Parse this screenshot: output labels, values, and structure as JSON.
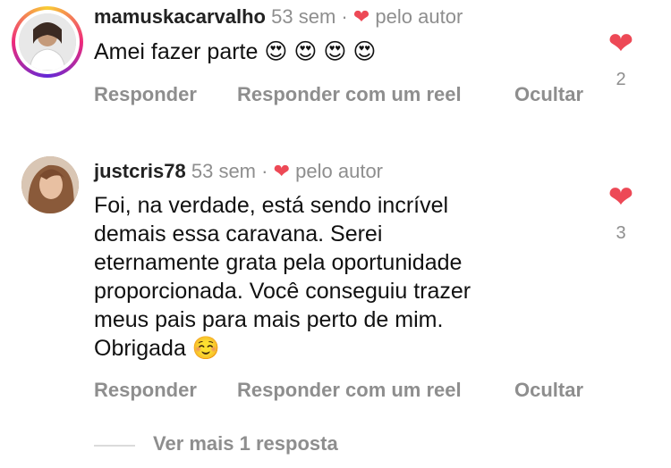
{
  "comments": [
    {
      "username": "mamuskacarvalho",
      "time": "53 sem",
      "separator": "·",
      "author_like_label": "pelo autor",
      "text": "Amei fazer parte 😍 😍 😍 😍",
      "actions": {
        "reply": "Responder",
        "reply_reel": "Responder com um reel",
        "hide": "Ocultar"
      },
      "likes": "2",
      "avatar_icon": "profile-photo-icon"
    },
    {
      "username": "justcris78",
      "time": "53 sem",
      "separator": "·",
      "author_like_label": "pelo autor",
      "text_lines": [
        "Foi, na verdade, está sendo incrível",
        "demais essa caravana. Serei",
        "eternamente grata pela oportunidade",
        "proporcionada. Você conseguiu trazer",
        "meus pais para mais perto de mim.",
        "Obrigada ☺️"
      ],
      "actions": {
        "reply": "Responder",
        "reply_reel": "Responder com um reel",
        "hide": "Ocultar"
      },
      "likes": "3",
      "avatar_icon": "profile-photo-icon"
    }
  ],
  "view_more": "Ver mais 1 resposta",
  "colors": {
    "heart": "#ed4956",
    "muted": "#8e8e8e",
    "text": "#111111"
  }
}
